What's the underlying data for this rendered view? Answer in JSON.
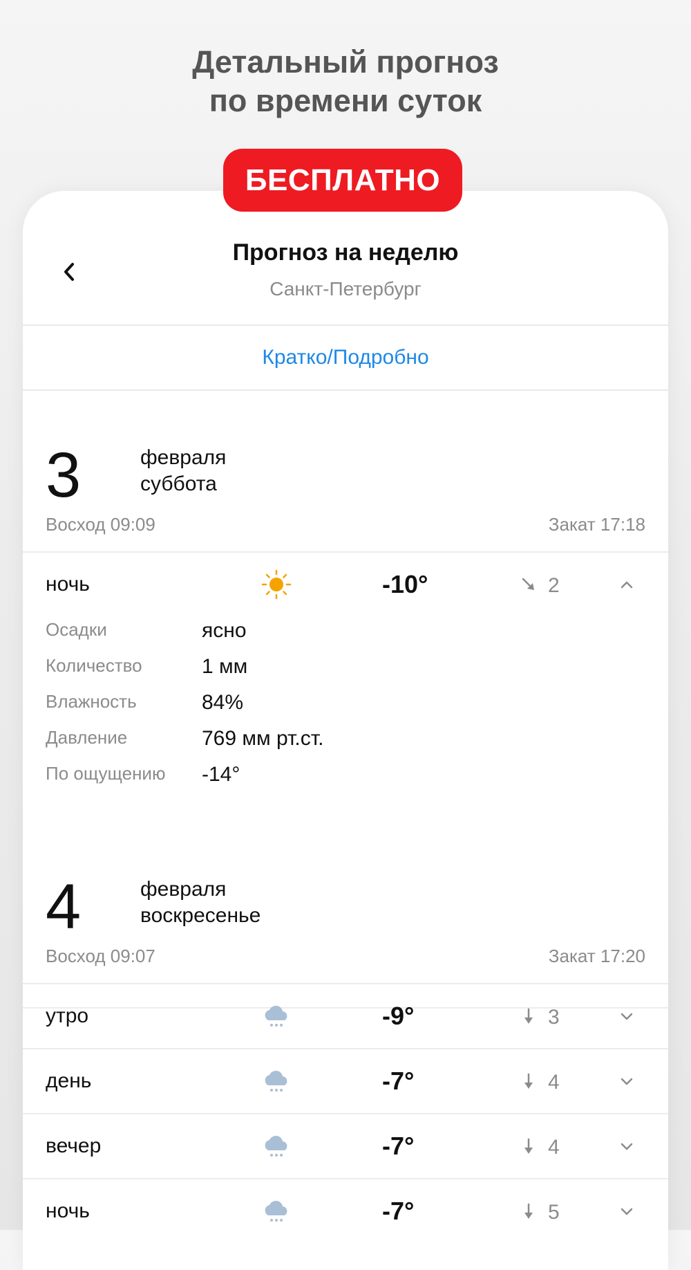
{
  "promo": {
    "title_line1": "Детальный прогноз",
    "title_line2": "по времени суток",
    "badge": "БЕСПЛАТНО"
  },
  "header": {
    "title": "Прогноз на неделю",
    "city": "Санкт-Петербург"
  },
  "toggle": {
    "label": "Кратко/Подробно"
  },
  "days": [
    {
      "number": "3",
      "month": "февраля",
      "weekday": "суббота",
      "sunrise": "Восход 09:09",
      "sunset": "Закат 17:18",
      "periods": [
        {
          "label": "ночь",
          "icon": "sun-icon",
          "temp": "-10°",
          "wind": "2",
          "wind_direction": "northwest",
          "expanded": true,
          "details": [
            {
              "key": "Осадки",
              "value": "ясно"
            },
            {
              "key": "Количество",
              "value": "1 мм"
            },
            {
              "key": "Влажность",
              "value": "84%"
            },
            {
              "key": "Давление",
              "value": "769 мм рт.ст."
            },
            {
              "key": "По ощущению",
              "value": "-14°"
            }
          ]
        }
      ]
    },
    {
      "number": "4",
      "month": "февраля",
      "weekday": "воскресенье",
      "sunrise": "Восход 09:07",
      "sunset": "Закат 17:20",
      "periods": [
        {
          "label": "утро",
          "icon": "snow-cloud-icon",
          "temp": "-9°",
          "wind": "3",
          "wind_direction": "north",
          "expanded": false
        },
        {
          "label": "день",
          "icon": "snow-cloud-icon",
          "temp": "-7°",
          "wind": "4",
          "wind_direction": "north",
          "expanded": false
        },
        {
          "label": "вечер",
          "icon": "snow-cloud-icon",
          "temp": "-7°",
          "wind": "4",
          "wind_direction": "north",
          "expanded": false
        },
        {
          "label": "ночь",
          "icon": "snow-cloud-icon",
          "temp": "-7°",
          "wind": "5",
          "wind_direction": "north",
          "expanded": false
        }
      ]
    }
  ],
  "colors": {
    "accent_link": "#1e88e5",
    "badge": "#ee1b22",
    "sun": "#f5a300",
    "snow_cloud": "#a9bfd6"
  }
}
